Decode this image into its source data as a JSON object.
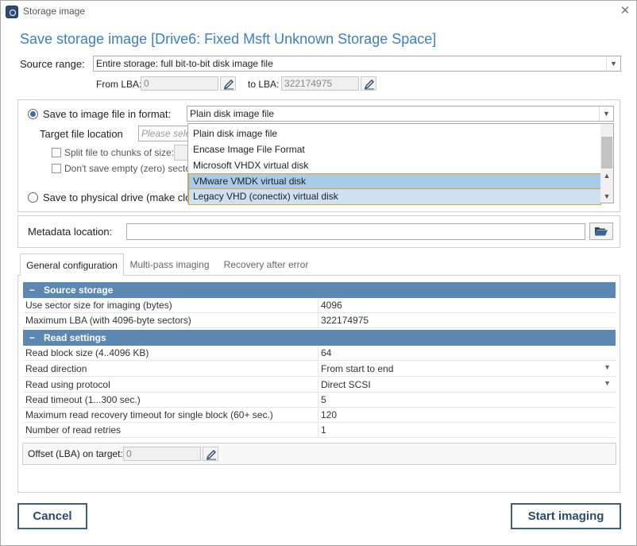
{
  "window": {
    "title": "Storage image",
    "heading": "Save storage image [Drive6: Fixed Msft Unknown Storage Space]"
  },
  "source": {
    "label": "Source range:",
    "value": "Entire storage: full bit-to-bit disk image file",
    "from_lba_label": "From LBA:",
    "from_lba_value": "0",
    "to_lba_label": "to LBA:",
    "to_lba_value": "322174975"
  },
  "image_file": {
    "radio_label": "Save to image file in format:",
    "format_value": "Plain disk image file",
    "target_label": "Target file location",
    "target_placeholder": "Please selec",
    "split_label": "Split file to chunks of size:",
    "dont_save_label": "Don't save empty (zero) sectors",
    "format_options": [
      "Plain disk image file",
      "Encase Image File Format",
      "Microsoft VHDX virtual disk",
      "VMware VMDK virtual disk",
      "Legacy VHD (conectix) virtual disk"
    ]
  },
  "physical": {
    "radio_label": "Save to physical drive (make clo"
  },
  "metadata": {
    "label": "Metadata location:",
    "value": ""
  },
  "tabs": [
    "General configuration",
    "Multi-pass imaging",
    "Recovery after error"
  ],
  "sections": {
    "source_storage": {
      "title": "Source storage",
      "rows": [
        {
          "key": "Use sector size for imaging (bytes)",
          "value": "4096"
        },
        {
          "key": "Maximum LBA (with 4096-byte sectors)",
          "value": "322174975"
        }
      ]
    },
    "read_settings": {
      "title": "Read settings",
      "rows": [
        {
          "key": "Read block size (4..4096 KB)",
          "value": "64"
        },
        {
          "key": "Read direction",
          "value": "From start to end"
        },
        {
          "key": "Read using protocol",
          "value": "Direct SCSI"
        },
        {
          "key": "Read timeout (1...300 sec.)",
          "value": "5"
        },
        {
          "key": "Maximum read recovery timeout for single block (60+ sec.)",
          "value": "120"
        },
        {
          "key": "Number of read retries",
          "value": "1"
        }
      ]
    }
  },
  "offset": {
    "label": "Offset (LBA) on target:",
    "value": "0"
  },
  "buttons": {
    "cancel": "Cancel",
    "start": "Start imaging"
  },
  "colors": {
    "accent": "#3b7fc4",
    "section_header": "#5c87b2",
    "highlight": "#a8cbea",
    "highlight_border": "#e0a030"
  }
}
